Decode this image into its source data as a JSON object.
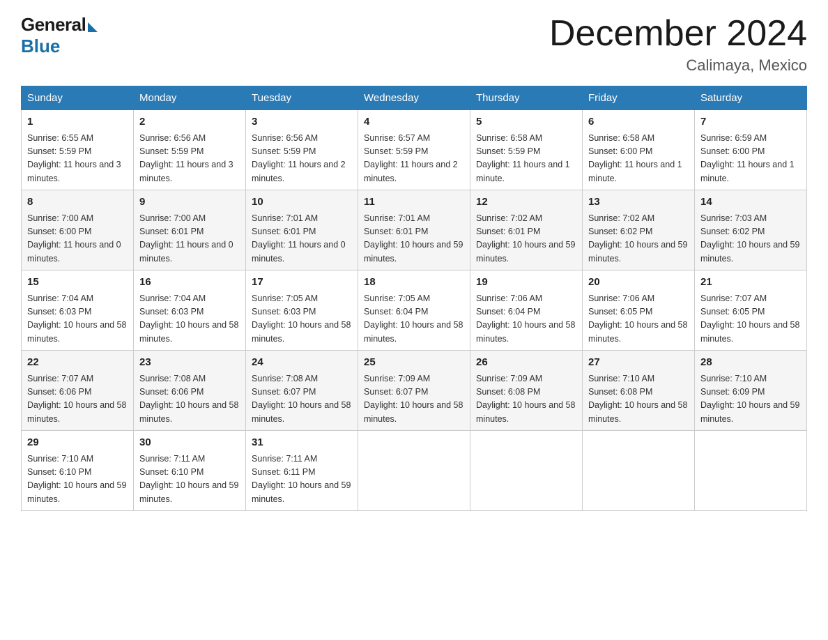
{
  "header": {
    "logo_general": "General",
    "logo_blue": "Blue",
    "month_title": "December 2024",
    "location": "Calimaya, Mexico"
  },
  "columns": [
    "Sunday",
    "Monday",
    "Tuesday",
    "Wednesday",
    "Thursday",
    "Friday",
    "Saturday"
  ],
  "weeks": [
    [
      {
        "day": "1",
        "sunrise": "6:55 AM",
        "sunset": "5:59 PM",
        "daylight": "11 hours and 3 minutes."
      },
      {
        "day": "2",
        "sunrise": "6:56 AM",
        "sunset": "5:59 PM",
        "daylight": "11 hours and 3 minutes."
      },
      {
        "day": "3",
        "sunrise": "6:56 AM",
        "sunset": "5:59 PM",
        "daylight": "11 hours and 2 minutes."
      },
      {
        "day": "4",
        "sunrise": "6:57 AM",
        "sunset": "5:59 PM",
        "daylight": "11 hours and 2 minutes."
      },
      {
        "day": "5",
        "sunrise": "6:58 AM",
        "sunset": "5:59 PM",
        "daylight": "11 hours and 1 minute."
      },
      {
        "day": "6",
        "sunrise": "6:58 AM",
        "sunset": "6:00 PM",
        "daylight": "11 hours and 1 minute."
      },
      {
        "day": "7",
        "sunrise": "6:59 AM",
        "sunset": "6:00 PM",
        "daylight": "11 hours and 1 minute."
      }
    ],
    [
      {
        "day": "8",
        "sunrise": "7:00 AM",
        "sunset": "6:00 PM",
        "daylight": "11 hours and 0 minutes."
      },
      {
        "day": "9",
        "sunrise": "7:00 AM",
        "sunset": "6:01 PM",
        "daylight": "11 hours and 0 minutes."
      },
      {
        "day": "10",
        "sunrise": "7:01 AM",
        "sunset": "6:01 PM",
        "daylight": "11 hours and 0 minutes."
      },
      {
        "day": "11",
        "sunrise": "7:01 AM",
        "sunset": "6:01 PM",
        "daylight": "10 hours and 59 minutes."
      },
      {
        "day": "12",
        "sunrise": "7:02 AM",
        "sunset": "6:01 PM",
        "daylight": "10 hours and 59 minutes."
      },
      {
        "day": "13",
        "sunrise": "7:02 AM",
        "sunset": "6:02 PM",
        "daylight": "10 hours and 59 minutes."
      },
      {
        "day": "14",
        "sunrise": "7:03 AM",
        "sunset": "6:02 PM",
        "daylight": "10 hours and 59 minutes."
      }
    ],
    [
      {
        "day": "15",
        "sunrise": "7:04 AM",
        "sunset": "6:03 PM",
        "daylight": "10 hours and 58 minutes."
      },
      {
        "day": "16",
        "sunrise": "7:04 AM",
        "sunset": "6:03 PM",
        "daylight": "10 hours and 58 minutes."
      },
      {
        "day": "17",
        "sunrise": "7:05 AM",
        "sunset": "6:03 PM",
        "daylight": "10 hours and 58 minutes."
      },
      {
        "day": "18",
        "sunrise": "7:05 AM",
        "sunset": "6:04 PM",
        "daylight": "10 hours and 58 minutes."
      },
      {
        "day": "19",
        "sunrise": "7:06 AM",
        "sunset": "6:04 PM",
        "daylight": "10 hours and 58 minutes."
      },
      {
        "day": "20",
        "sunrise": "7:06 AM",
        "sunset": "6:05 PM",
        "daylight": "10 hours and 58 minutes."
      },
      {
        "day": "21",
        "sunrise": "7:07 AM",
        "sunset": "6:05 PM",
        "daylight": "10 hours and 58 minutes."
      }
    ],
    [
      {
        "day": "22",
        "sunrise": "7:07 AM",
        "sunset": "6:06 PM",
        "daylight": "10 hours and 58 minutes."
      },
      {
        "day": "23",
        "sunrise": "7:08 AM",
        "sunset": "6:06 PM",
        "daylight": "10 hours and 58 minutes."
      },
      {
        "day": "24",
        "sunrise": "7:08 AM",
        "sunset": "6:07 PM",
        "daylight": "10 hours and 58 minutes."
      },
      {
        "day": "25",
        "sunrise": "7:09 AM",
        "sunset": "6:07 PM",
        "daylight": "10 hours and 58 minutes."
      },
      {
        "day": "26",
        "sunrise": "7:09 AM",
        "sunset": "6:08 PM",
        "daylight": "10 hours and 58 minutes."
      },
      {
        "day": "27",
        "sunrise": "7:10 AM",
        "sunset": "6:08 PM",
        "daylight": "10 hours and 58 minutes."
      },
      {
        "day": "28",
        "sunrise": "7:10 AM",
        "sunset": "6:09 PM",
        "daylight": "10 hours and 59 minutes."
      }
    ],
    [
      {
        "day": "29",
        "sunrise": "7:10 AM",
        "sunset": "6:10 PM",
        "daylight": "10 hours and 59 minutes."
      },
      {
        "day": "30",
        "sunrise": "7:11 AM",
        "sunset": "6:10 PM",
        "daylight": "10 hours and 59 minutes."
      },
      {
        "day": "31",
        "sunrise": "7:11 AM",
        "sunset": "6:11 PM",
        "daylight": "10 hours and 59 minutes."
      },
      null,
      null,
      null,
      null
    ]
  ]
}
